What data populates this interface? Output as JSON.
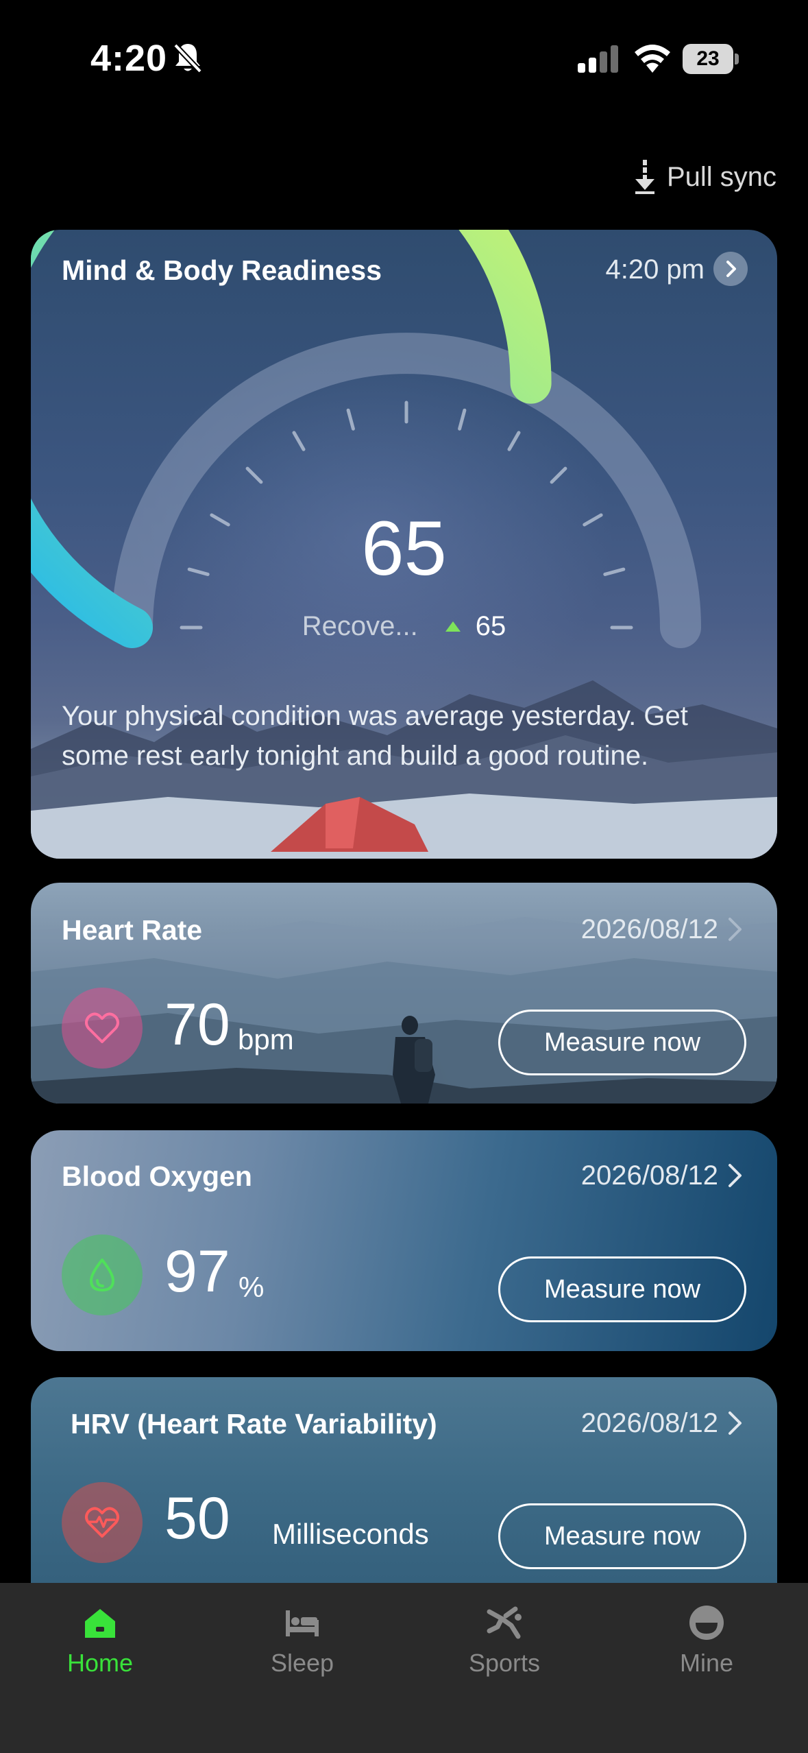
{
  "status_bar": {
    "time": "4:20",
    "battery": "23"
  },
  "header": {
    "pull_sync": "Pull sync"
  },
  "readiness": {
    "title": "Mind & Body Readiness",
    "time": "4:20 pm",
    "score": "65",
    "gauge_level": 0.65,
    "status_label": "Recove...",
    "change_value": "65",
    "description": "Your physical condition was average yesterday. Get some rest early tonight and build a good routine.",
    "colors": {
      "gauge_start": "#1fb6f0",
      "gauge_end": "#d4f66a",
      "track": "#8a9bb8",
      "up": "#7ee35a"
    }
  },
  "heart_rate": {
    "title": "Heart Rate",
    "date": "2026/08/12",
    "value": "70",
    "unit": "bpm",
    "button": "Measure now",
    "icon": "heart-icon",
    "icon_color": "#ff6fa0"
  },
  "blood_oxygen": {
    "title": "Blood Oxygen",
    "date": "2026/08/12",
    "value": "97",
    "unit": "%",
    "button": "Measure now",
    "icon": "droplet-icon",
    "icon_color": "#4fe05a"
  },
  "hrv": {
    "title": "HRV (Heart Rate Variability)",
    "date": "2026/08/12",
    "value": "50",
    "unit": "Milliseconds",
    "button": "Measure now",
    "icon": "heart-pulse-icon",
    "icon_color": "#ff5a5a"
  },
  "tabs": [
    {
      "label": "Home",
      "icon": "home-icon",
      "active": true
    },
    {
      "label": "Sleep",
      "icon": "bed-icon",
      "active": false
    },
    {
      "label": "Sports",
      "icon": "running-icon",
      "active": false
    },
    {
      "label": "Mine",
      "icon": "profile-icon",
      "active": false
    }
  ]
}
